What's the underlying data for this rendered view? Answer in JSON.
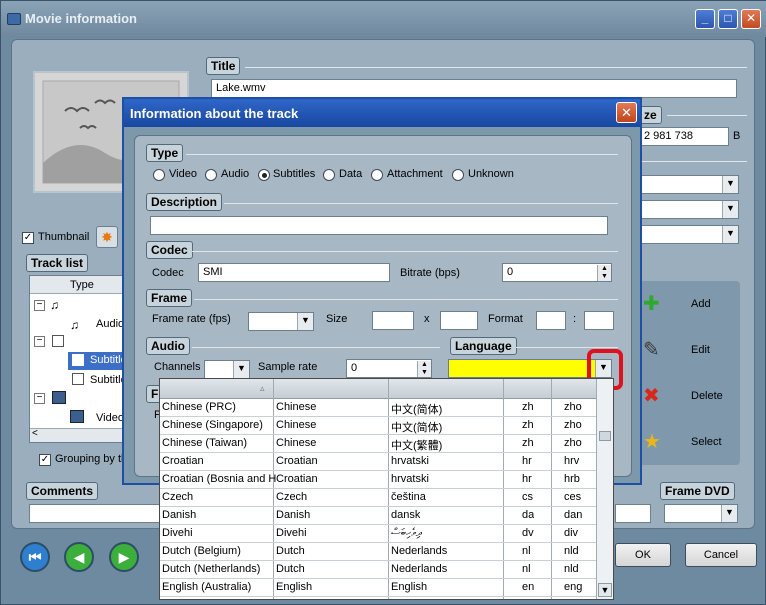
{
  "window": {
    "title": "Movie information",
    "min": "_",
    "max": "□",
    "close": "✕"
  },
  "main": {
    "title_label": "Title",
    "title_value": "Lake.wmv",
    "size_label": "ze",
    "size_value": "2 981 738",
    "size_unit": "B",
    "thumbnail_label": "Thumbnail",
    "tracklist_label": "Track list",
    "type_col": "Type",
    "tracks": [
      "Audio",
      "Subtitle",
      "Subtitle",
      "Video"
    ],
    "grouping_label": "Grouping by th",
    "comments_label": "Comments",
    "frame_dvd_label": "Frame DVD",
    "side_buttons": {
      "add": "Add",
      "edit": "Edit",
      "delete": "Delete",
      "select": "Select"
    },
    "ok": "OK",
    "cancel": "Cancel"
  },
  "dialog": {
    "title": "Information about the track",
    "close": "✕",
    "type_label": "Type",
    "types": [
      "Video",
      "Audio",
      "Subtitles",
      "Data",
      "Attachment",
      "Unknown"
    ],
    "selected_type": "Subtitles",
    "description_label": "Description",
    "description_value": "",
    "codec_section": "Codec",
    "codec_label": "Codec",
    "codec_value": "SMI",
    "bitrate_label": "Bitrate (bps)",
    "bitrate_value": "0",
    "frame_section": "Frame",
    "frame_rate_label": "Frame rate (fps)",
    "size_label": "Size",
    "x_sep": "x",
    "format_label": "Format",
    "colon_sep": ":",
    "audio_section": "Audio",
    "channels_label": "Channels",
    "sample_rate_label": "Sample rate",
    "sample_rate_value": "0",
    "language_section": "Language",
    "frame_partial": "Fr",
    "p_partial": "P"
  },
  "language_list": {
    "sort_indicator": "▵",
    "rows": [
      [
        "Chinese (PRC)",
        "Chinese",
        "中文(简体)",
        "zh",
        "zho"
      ],
      [
        "Chinese (Singapore)",
        "Chinese",
        "中文(简体)",
        "zh",
        "zho"
      ],
      [
        "Chinese (Taiwan)",
        "Chinese",
        "中文(繁體)",
        "zh",
        "zho"
      ],
      [
        "Croatian",
        "Croatian",
        "hrvatski",
        "hr",
        "hrv"
      ],
      [
        "Croatian (Bosnia and H",
        "Croatian",
        "hrvatski",
        "hr",
        "hrb"
      ],
      [
        "Czech",
        "Czech",
        "čeština",
        "cs",
        "ces"
      ],
      [
        "Danish",
        "Danish",
        "dansk",
        "da",
        "dan"
      ],
      [
        "Divehi",
        "Divehi",
        "ދިވެހިބަސް",
        "dv",
        "div"
      ],
      [
        "Dutch (Belgium)",
        "Dutch",
        "Nederlands",
        "nl",
        "nld"
      ],
      [
        "Dutch (Netherlands)",
        "Dutch",
        "Nederlands",
        "nl",
        "nld"
      ],
      [
        "English (Australia)",
        "English",
        "English",
        "en",
        "eng"
      ]
    ]
  },
  "colors": {
    "language_field": "#ffff00",
    "highlight": "#e0101e",
    "dialog_title": "#1847a0"
  }
}
